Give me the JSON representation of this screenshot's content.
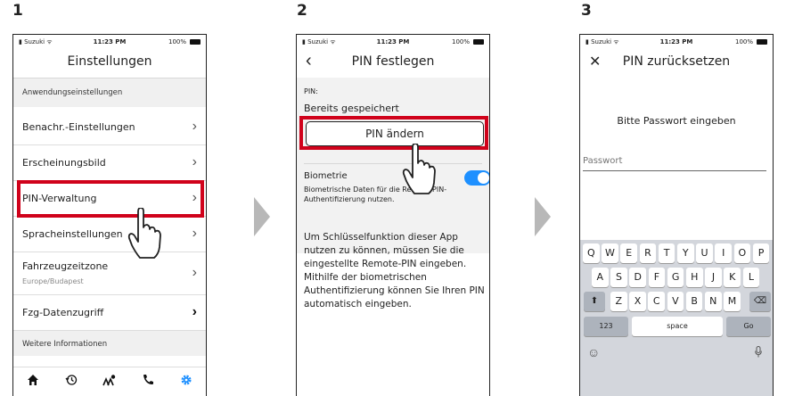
{
  "steps": [
    "1",
    "2",
    "3"
  ],
  "status": {
    "carrier": "Suzuki",
    "time": "11:23 PM",
    "battery": "100%"
  },
  "screen1": {
    "title": "Einstellungen",
    "section1": "Anwendungseinstellungen",
    "rows": [
      {
        "label": "Benachr.-Einstellungen"
      },
      {
        "label": "Erscheinungsbild"
      },
      {
        "label": "PIN-Verwaltung"
      },
      {
        "label": "Spracheinstellungen"
      },
      {
        "label": "Fahrzeugzeitzone",
        "sub": "Europe/Budapest"
      },
      {
        "label": "Fzg-Datenzugriff"
      }
    ],
    "section2": "Weitere Informationen"
  },
  "screen2": {
    "title": "PIN festlegen",
    "pin_label": "PIN:",
    "pin_status": "Bereits gespeichert",
    "button": "PIN ändern",
    "biometric_label": "Biometrie",
    "biometric_desc": "Biometrische Daten für die Remote-PIN-Authentifizierung nutzen.",
    "info": "Um Schlüsselfunktion dieser App nutzen zu können, müssen Sie die eingestellte Remote-PIN eingeben. Mithilfe der biometrischen Authentifizierung können Sie Ihren PIN automatisch eingeben."
  },
  "screen3": {
    "title": "PIN zurücksetzen",
    "prompt": "Bitte Passwort eingeben",
    "placeholder": "Passwort",
    "keyboard": {
      "row1": [
        "Q",
        "W",
        "E",
        "R",
        "T",
        "Y",
        "U",
        "I",
        "O",
        "P"
      ],
      "row2": [
        "A",
        "S",
        "D",
        "F",
        "G",
        "H",
        "J",
        "K",
        "L"
      ],
      "row3": [
        "Z",
        "X",
        "C",
        "V",
        "B",
        "N",
        "M"
      ],
      "num": "123",
      "space": "space",
      "go": "Go"
    }
  },
  "colors": {
    "accent_red": "#d0021b",
    "toggle_blue": "#1e90ff",
    "settings_blue": "#1e90ff"
  }
}
